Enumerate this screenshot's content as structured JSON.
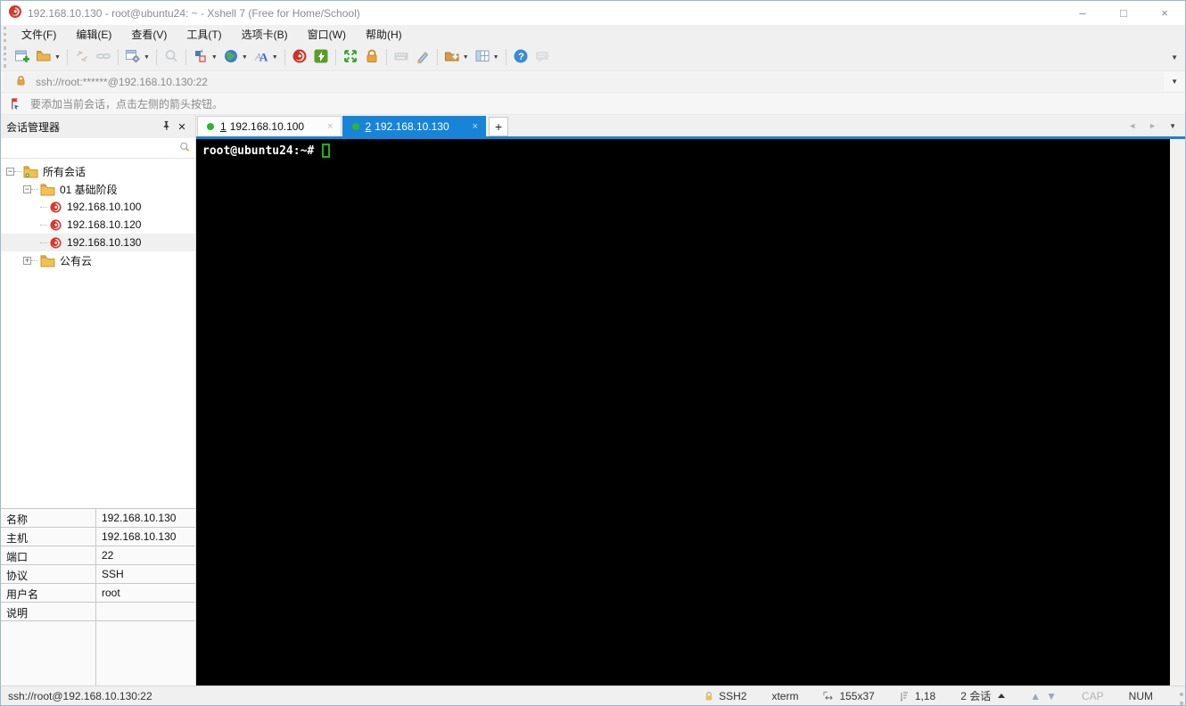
{
  "window": {
    "title": "192.168.10.130 - root@ubuntu24: ~ - Xshell 7 (Free for Home/School)",
    "minimize": "–",
    "maximize": "□",
    "close": "×"
  },
  "menu": {
    "items": [
      {
        "label": "文件(F)"
      },
      {
        "label": "编辑(E)"
      },
      {
        "label": "查看(V)"
      },
      {
        "label": "工具(T)"
      },
      {
        "label": "选项卡(B)"
      },
      {
        "label": "窗口(W)"
      },
      {
        "label": "帮助(H)"
      }
    ]
  },
  "toolbar": {
    "icons": [
      "new-session-icon",
      "open-folder-icon",
      "disconnect-icon",
      "reconnect-icon",
      "session-properties-icon",
      "find-icon",
      "compose-icon",
      "web-icon",
      "font-icon",
      "xshell-icon",
      "xftp-icon",
      "fullscreen-icon",
      "lock-icon",
      "virtual-keyboard-icon",
      "highlight-icon",
      "new-file-icon",
      "layout-icon",
      "help-icon",
      "feedback-icon"
    ]
  },
  "address_bar": {
    "value": "ssh://root:******@192.168.10.130:22"
  },
  "info_bar": {
    "text": "要添加当前会话，点击左侧的箭头按钮。"
  },
  "sidebar": {
    "title": "会话管理器",
    "search_placeholder": "",
    "tree": [
      {
        "label": "所有会话"
      },
      {
        "label": "01 基础阶段"
      },
      {
        "label": "192.168.10.100"
      },
      {
        "label": "192.168.10.120"
      },
      {
        "label": "192.168.10.130"
      },
      {
        "label": "公有云"
      }
    ],
    "properties": [
      {
        "label": "名称",
        "value": "192.168.10.130"
      },
      {
        "label": "主机",
        "value": "192.168.10.130"
      },
      {
        "label": "端口",
        "value": "22"
      },
      {
        "label": "协议",
        "value": "SSH"
      },
      {
        "label": "用户名",
        "value": "root"
      },
      {
        "label": "说明",
        "value": ""
      }
    ]
  },
  "tabs": {
    "items": [
      {
        "number": "1",
        "label": "192.168.10.100",
        "close": "×"
      },
      {
        "number": "2",
        "label": "192.168.10.130",
        "close": "×"
      }
    ],
    "add_label": "+"
  },
  "terminal": {
    "prompt": "root@ubuntu24:~#"
  },
  "status_bar": {
    "left": "ssh://root@192.168.10.130:22",
    "protocol": "SSH2",
    "term_type": "xterm",
    "size": "155x37",
    "position": "1,18",
    "sessions": "2 会话",
    "cap": "CAP",
    "num": "NUM"
  },
  "colors": {
    "accent": "#1784d8",
    "session_icon_red": "#d6382c",
    "connected_green": "#2db52d",
    "cursor_green": "#17b417",
    "folder_yellow": "#f2c14e",
    "lock_orange": "#e8a33c"
  }
}
